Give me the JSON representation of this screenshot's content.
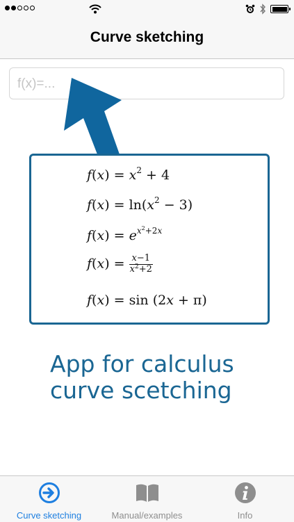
{
  "status_bar": {
    "signal_filled": 2,
    "signal_total": 5,
    "icons": [
      "wifi-icon",
      "alarm-icon",
      "bluetooth-icon",
      "battery-icon"
    ],
    "battery_level": 1.0
  },
  "nav": {
    "title": "Curve sketching"
  },
  "input": {
    "placeholder": "f(x)=...",
    "value": ""
  },
  "examples": {
    "f1": "f(x) = x² + 4",
    "f2": "f(x) = ln(x² − 3)",
    "f3": "f(x) = e^(x²+2x)",
    "f4": "f(x) = (x−1)/(x²+2)",
    "f5": "f(x) = sin (2x + π)"
  },
  "tagline": {
    "line1": "App for calculus",
    "line2": "curve scetching"
  },
  "tabs": [
    {
      "label": "Curve sketching",
      "icon": "arrow-right-circle-icon",
      "active": true
    },
    {
      "label": "Manual/examples",
      "icon": "book-icon",
      "active": false
    },
    {
      "label": "Info",
      "icon": "info-icon",
      "active": false
    }
  ],
  "colors": {
    "accent": "#1a6693",
    "arrow": "#10669e",
    "tab_active": "#1e7fe0",
    "tab_inactive": "#8e8e8e"
  }
}
